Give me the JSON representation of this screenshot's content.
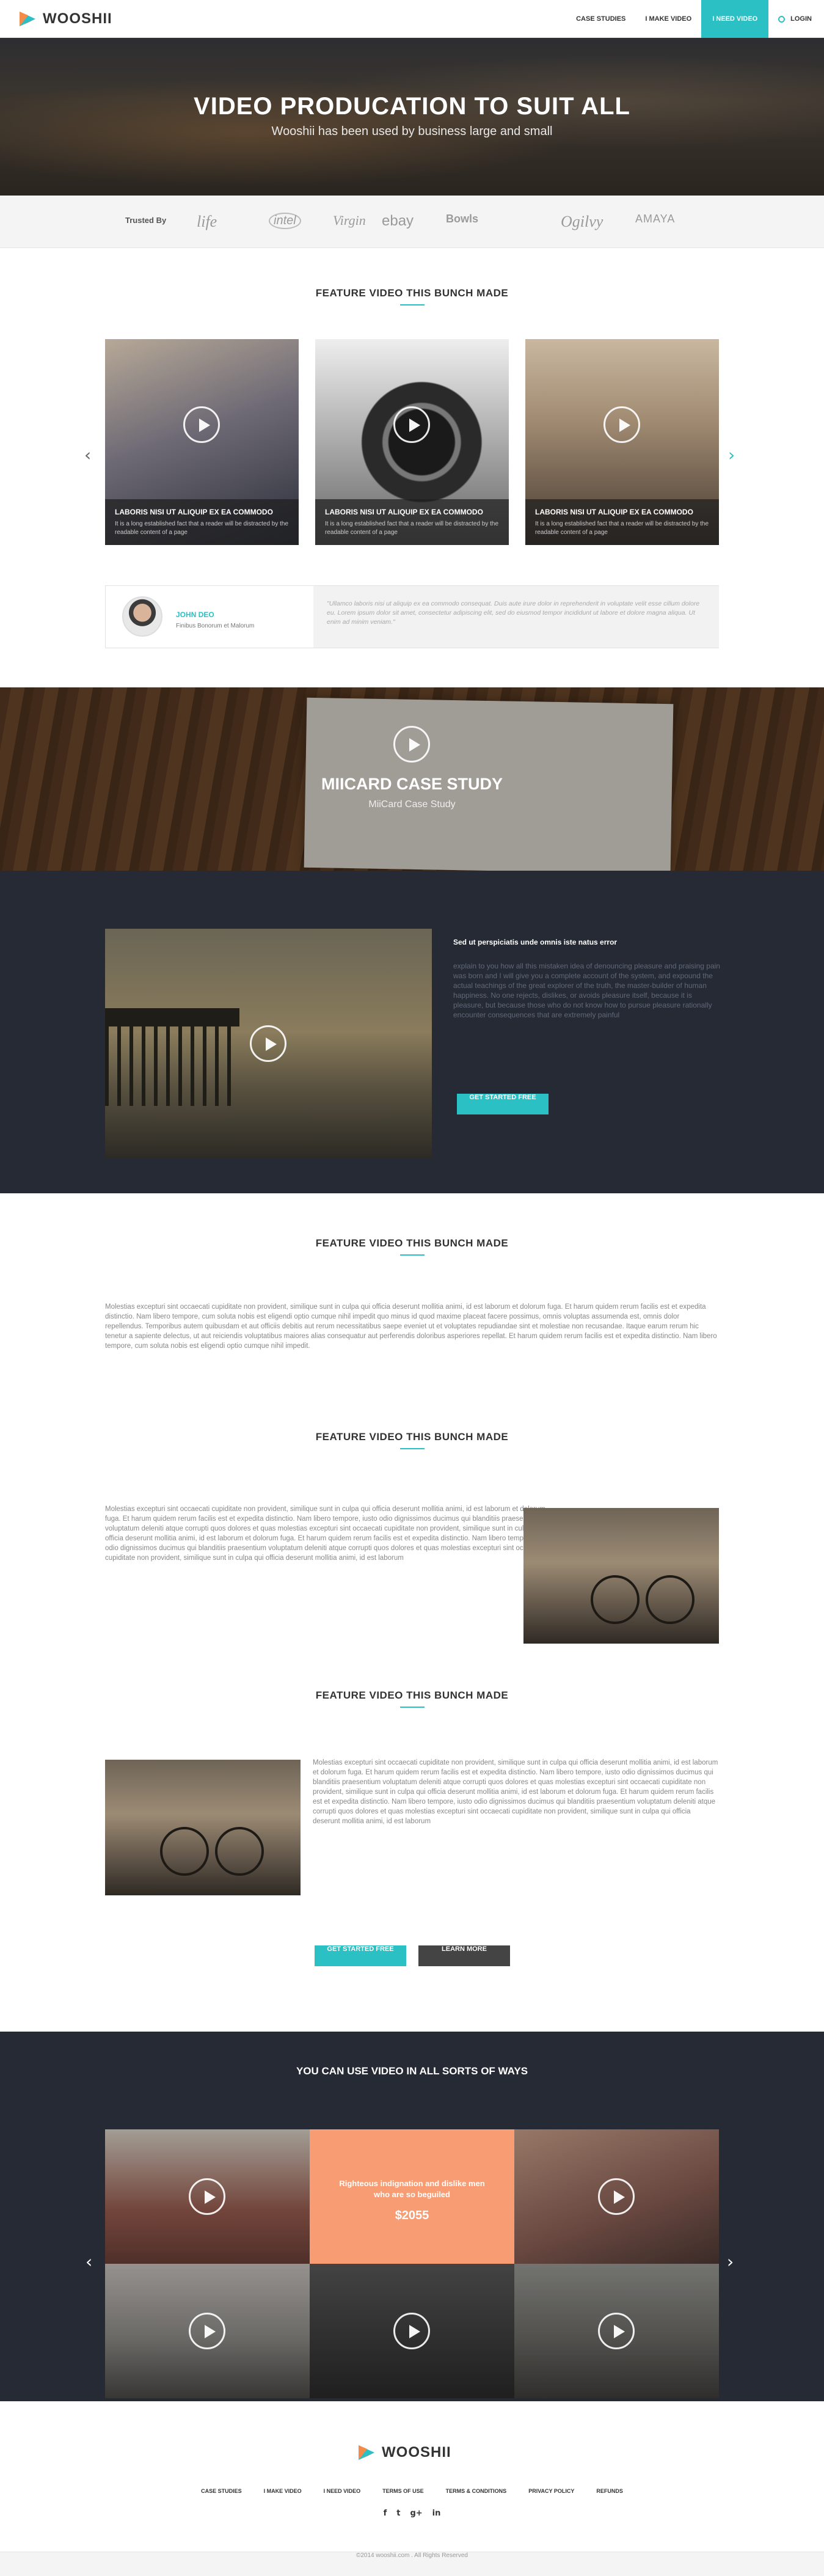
{
  "brand": {
    "name": "WOOSHII",
    "accent": "#2bc0c4",
    "dark": "#252a35",
    "promo": "#f79c73"
  },
  "nav": {
    "items": [
      "CASE STUDIES",
      "I MAKE VIDEO",
      "I NEED VIDEO"
    ],
    "login": "LOGIN"
  },
  "hero": {
    "title": "VIDEO PRODUCATION TO SUIT ALL",
    "subtitle": "Wooshii has been used by business large and small"
  },
  "trusted": {
    "label": "Trusted By",
    "brands": [
      "life",
      "intel",
      "Virgin",
      "ebay",
      "Bowls",
      "Ogilvy",
      "AMAYA"
    ]
  },
  "featured": {
    "title": "FEATURE VIDEO THIS BUNCH MADE",
    "cards": [
      {
        "title": "LABORIS NISI UT ALIQUIP EX EA COMMODO",
        "desc": "It is a long established fact that a reader will be distracted by the readable content of a page"
      },
      {
        "title": "LABORIS NISI UT ALIQUIP EX EA COMMODO",
        "desc": "It is a long established fact that a reader will be distracted by the readable content of a page"
      },
      {
        "title": "LABORIS NISI UT ALIQUIP EX EA COMMODO",
        "desc": "It is a long established fact that a reader will be distracted by the readable content of a page"
      }
    ],
    "prev_icon": "chevron-left-icon",
    "next_icon": "chevron-right-icon"
  },
  "testimonial": {
    "name": "JOHN DEO",
    "role": "Finibus Bonorum et Malorum",
    "quote": "\"Ullamco laboris nisi ut aliquip ex ea commodo consequat. Duis aute irure dolor in reprehenderit in voluptate velit esse cillum dolore eu. Lorem ipsum dolor sit amet, consectetur adipiscing elit, sed do eiusmod tempor incididunt ut labore et dolore magna aliqua. Ut enim ad minim veniam.\""
  },
  "case_study": {
    "title": "MIICARD CASE STUDY",
    "subtitle": "MiiCard Case Study"
  },
  "dark_video": {
    "title": "Sed ut perspiciatis unde omnis iste natus error",
    "text": "explain to you how all this mistaken idea of denouncing pleasure and praising pain was born and I will give you a complete account of the system, and expound the actual teachings of the great explorer of the truth, the master-builder of human happiness. No one rejects, dislikes, or avoids pleasure itself, because it is pleasure, but because those who do not know how to pursue pleasure rationally encounter consequences that are extremely painful",
    "button": "GET STARTED FREE"
  },
  "text_section_1": {
    "title": "FEATURE VIDEO THIS BUNCH MADE",
    "text": "Molestias excepturi sint occaecati cupiditate non provident, similique sunt in culpa qui officia deserunt mollitia animi, id est laborum et dolorum fuga. Et harum quidem rerum facilis est et expedita distinctio. Nam libero tempore, cum soluta nobis est eligendi optio cumque nihil impedit quo minus id quod maxime placeat facere possimus, omnis voluptas assumenda est, omnis dolor repellendus. Temporibus autem quibusdam et aut officiis debitis aut rerum necessitatibus saepe eveniet ut et voluptates repudiandae sint et molestiae non recusandae. Itaque earum rerum hic tenetur a sapiente delectus, ut aut reiciendis voluptatibus maiores alias consequatur aut perferendis doloribus asperiores repellat. Et harum quidem rerum facilis est et expedita distinctio. Nam libero tempore, cum soluta nobis est eligendi optio cumque nihil impedit."
  },
  "text_section_2": {
    "title": "FEATURE VIDEO THIS BUNCH MADE",
    "text": "Molestias excepturi sint occaecati cupiditate non provident, similique sunt in culpa qui officia deserunt mollitia animi, id est laborum et dolorum fuga. Et harum quidem rerum facilis est et expedita distinctio. Nam libero tempore, iusto odio dignissimos ducimus qui blanditiis praesentium voluptatum deleniti atque corrupti quos dolores et quas molestias excepturi sint occaecati cupiditate non provident, similique sunt in culpa qui officia deserunt mollitia animi, id est laborum et dolorum fuga. Et harum quidem rerum facilis est et expedita distinctio. Nam libero tempore, iusto odio dignissimos ducimus qui blanditiis praesentium voluptatum deleniti atque corrupti quos dolores et quas molestias excepturi sint occaecati cupiditate non provident, similique sunt in culpa qui officia deserunt mollitia animi, id est laborum"
  },
  "text_section_3": {
    "title": "FEATURE VIDEO THIS BUNCH MADE",
    "text": "Molestias excepturi sint occaecati cupiditate non provident, similique sunt in culpa qui officia deserunt mollitia animi, id est laborum et dolorum fuga. Et harum quidem rerum facilis est et expedita distinctio. Nam libero tempore, iusto odio dignissimos ducimus qui blanditiis praesentium voluptatum deleniti atque corrupti quos dolores et quas molestias excepturi sint occaecati cupiditate non provident, similique sunt in culpa qui officia deserunt mollitia animi, id est laborum et dolorum fuga. Et harum quidem rerum facilis est et expedita distinctio. Nam libero tempore, iusto odio dignissimos ducimus qui blanditiis praesentium voluptatum deleniti atque corrupti quos dolores et quas molestias excepturi sint occaecati cupiditate non provident, similique sunt in culpa qui officia deserunt mollitia animi, id est laborum",
    "btn_start": "GET STARTED FREE",
    "btn_more": "LEARN MORE"
  },
  "ways": {
    "title": "YOU CAN USE VIDEO IN ALL SORTS OF WAYS",
    "promo_text": "Righteous indignation and dislike men who are so beguiled",
    "promo_price": "$2055"
  },
  "footer": {
    "brand": "WOOSHII",
    "links": [
      "CASE STUDIES",
      "I MAKE VIDEO",
      "I NEED VIDEO",
      "TERMS OF USE",
      "TERMS & CONDITIONS",
      "PRIVACY POLICY",
      "REFUNDS"
    ],
    "social": [
      "f",
      "t",
      "g+",
      "in"
    ],
    "copyright": "©2014 wooshii.com . All Rights Reserved"
  }
}
